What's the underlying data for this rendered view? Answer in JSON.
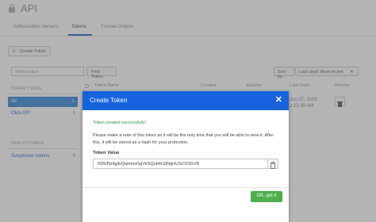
{
  "header": {
    "title": "API"
  },
  "tabs": [
    {
      "label": "Authorization Servers"
    },
    {
      "label": "Tokens"
    },
    {
      "label": "Trusted Origins"
    }
  ],
  "toolbar": {
    "create_label": "Create Token"
  },
  "filter": {
    "search_placeholder": "Token value",
    "find_label": "Find Token",
    "sort_label": "Sort by",
    "sort_value": "Last used: Most recent"
  },
  "table": {
    "columns": [
      "Token Name",
      "Created",
      "Expires",
      "Last Used",
      "Revoke"
    ],
    "row": {
      "last_used_date": "Jun 07, 2019",
      "last_used_time": "2:23:39 AM"
    }
  },
  "sidebar": {
    "token_types_header": "TOKEN TYPES",
    "items": [
      {
        "label": "All",
        "count": "1"
      },
      {
        "label": "Okta API",
        "count": "1"
      }
    ],
    "health_header": "HEALTH CHECK",
    "health_items": [
      {
        "label": "Suspicious tokens",
        "count": "0"
      }
    ]
  },
  "modal": {
    "title": "Create Token",
    "success": "Token created successfully!",
    "message": "Please make a note of this token as it will be the only time that you will be able to view it. After this, it will be stored as a hash for your protection.",
    "token_label": "Token Value",
    "token_value": "00fUPpItgjlxQqmmsGgVeSQub4n2jNgivUSCD3GV8",
    "ok_label": "OK, got it"
  },
  "colors": {
    "accent": "#1662dd",
    "success": "#4cae4c"
  }
}
